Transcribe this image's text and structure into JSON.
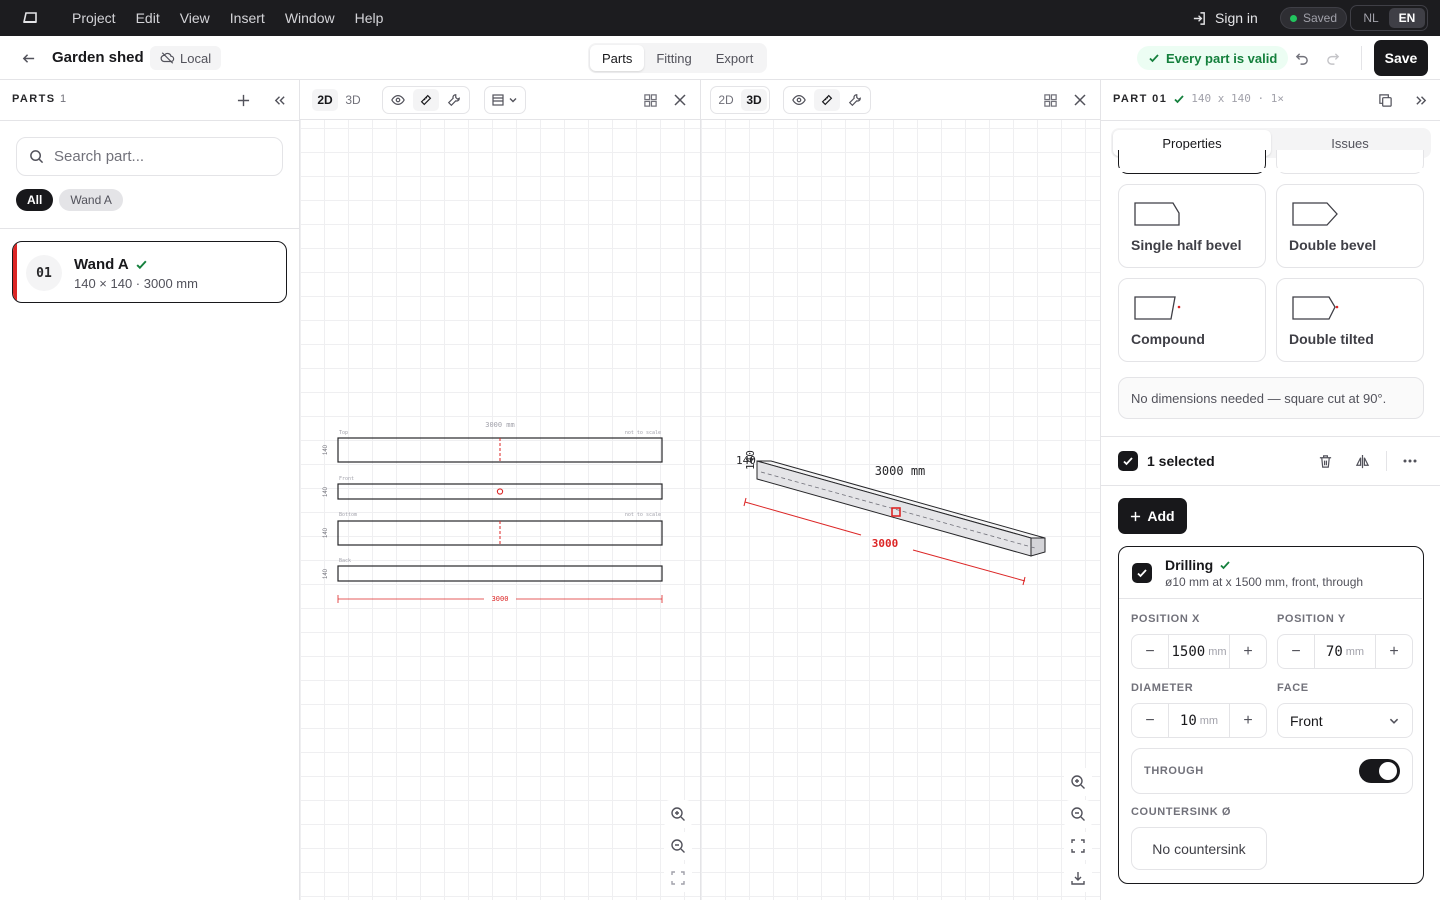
{
  "menubar": {
    "items": [
      "Project",
      "Edit",
      "View",
      "Insert",
      "Window",
      "Help"
    ],
    "sign_in": "Sign in",
    "saved": "Saved",
    "lang": [
      "NL",
      "EN"
    ]
  },
  "toolbar": {
    "project_title": "Garden shed",
    "storage": "Local",
    "tabs": [
      "Parts",
      "Fitting",
      "Export"
    ],
    "valid": "Every part is valid",
    "save": "Save"
  },
  "parts_panel": {
    "title": "PARTS",
    "count": "1",
    "search_placeholder": "Search part...",
    "filters": [
      "All",
      "Wand A"
    ],
    "part": {
      "number": "01",
      "name": "Wand A",
      "dims": "140 × 140 · 3000 mm"
    }
  },
  "view2d": {
    "modes": [
      "2D",
      "3D"
    ],
    "labels": {
      "length": "3000 mm",
      "top": "Top",
      "front": "Front",
      "bottom": "Bottom",
      "back": "Back",
      "scale": "not to scale",
      "side": "140",
      "total": "3000"
    }
  },
  "view3d": {
    "modes": [
      "2D",
      "3D"
    ],
    "labels": {
      "side_a": "140",
      "side_b": "140",
      "length": "3000 mm",
      "dim": "3000"
    }
  },
  "inspector": {
    "part_label": "PART 01",
    "part_meta": "140 x 140 · 1×",
    "tabs": [
      "Properties",
      "Issues"
    ],
    "cuts": [
      "Single half bevel",
      "Double bevel",
      "Compound",
      "Double tilted"
    ],
    "cut_note": "No dimensions needed — square cut at 90°.",
    "selected": "1 selected",
    "add": "Add",
    "op": {
      "name": "Drilling",
      "desc": "ø10 mm at x 1500 mm, front, through",
      "pos_x_label": "POSITION X",
      "pos_x": "1500",
      "pos_y_label": "POSITION Y",
      "pos_y": "70",
      "diameter_label": "DIAMETER",
      "diameter": "10",
      "face_label": "FACE",
      "face": "Front",
      "through_label": "THROUGH",
      "through": true,
      "countersink_label": "COUNTERSINK Ø",
      "countersink": "No countersink",
      "unit": "mm"
    }
  },
  "colors": {
    "accent": "#18181b",
    "valid": "#15803d",
    "drill": "#dc2626",
    "part_bar": "#dc2626"
  }
}
